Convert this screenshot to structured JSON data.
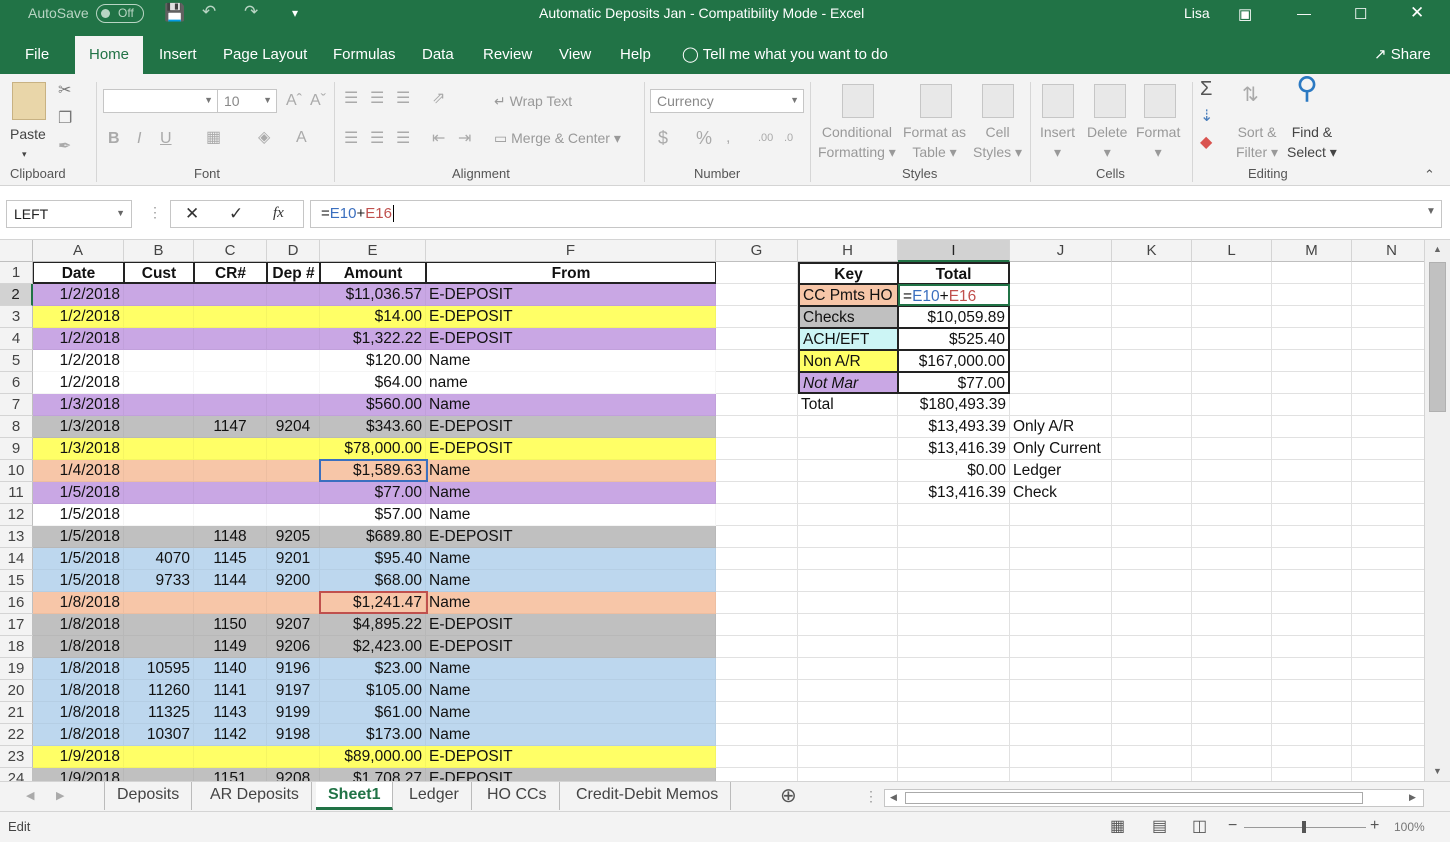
{
  "titlebar": {
    "autosave_label": "AutoSave",
    "autosave_state": "Off",
    "title": "Automatic Deposits Jan  -  Compatibility Mode  -  Excel",
    "user": "Lisa"
  },
  "ribbon_tabs": [
    "File",
    "Home",
    "Insert",
    "Page Layout",
    "Formulas",
    "Data",
    "Review",
    "View",
    "Help"
  ],
  "tell_me": "Tell me what you want to do",
  "share": "Share",
  "ribbon": {
    "paste": "Paste",
    "font_name": "",
    "font_size": "10",
    "wrap_text": "Wrap Text",
    "merge_center": "Merge & Center",
    "number_format": "Currency",
    "conditional_formatting": [
      "Conditional",
      "Formatting"
    ],
    "format_as_table": [
      "Format as",
      "Table"
    ],
    "cell_styles": [
      "Cell",
      "Styles"
    ],
    "insert": "Insert",
    "delete": "Delete",
    "format": "Format",
    "sort_filter": [
      "Sort &",
      "Filter"
    ],
    "find_select": [
      "Find &",
      "Select"
    ],
    "groups": [
      "Clipboard",
      "Font",
      "Alignment",
      "Number",
      "Styles",
      "Cells",
      "Editing"
    ]
  },
  "formula_bar": {
    "name_box": "LEFT",
    "formula": "=E10+E16",
    "fx": "fx"
  },
  "columns": [
    "A",
    "B",
    "C",
    "D",
    "E",
    "F",
    "G",
    "H",
    "I",
    "J",
    "K",
    "L",
    "M",
    "N"
  ],
  "selected_column": "I",
  "header_row": [
    "Date",
    "Cust",
    "CR#",
    "Dep #",
    "Amount",
    "From"
  ],
  "rows": [
    {
      "n": "2",
      "date": "1/2/2018",
      "cust": "",
      "cr": "",
      "dep": "",
      "amount": "$11,036.57",
      "from": "E-DEPOSIT",
      "color": "#c9a7e4"
    },
    {
      "n": "3",
      "date": "1/2/2018",
      "cust": "",
      "cr": "",
      "dep": "",
      "amount": "$14.00",
      "from": "E-DEPOSIT",
      "color": "#ffff66"
    },
    {
      "n": "4",
      "date": "1/2/2018",
      "cust": "",
      "cr": "",
      "dep": "",
      "amount": "$1,322.22",
      "from": "E-DEPOSIT",
      "color": "#c9a7e4"
    },
    {
      "n": "5",
      "date": "1/2/2018",
      "cust": "",
      "cr": "",
      "dep": "",
      "amount": "$120.00",
      "from": "Name",
      "color": "#ffffff"
    },
    {
      "n": "6",
      "date": "1/2/2018",
      "cust": "",
      "cr": "",
      "dep": "",
      "amount": "$64.00",
      "from": "name",
      "color": "#ffffff"
    },
    {
      "n": "7",
      "date": "1/3/2018",
      "cust": "",
      "cr": "",
      "dep": "",
      "amount": "$560.00",
      "from": "Name",
      "color": "#c9a7e4"
    },
    {
      "n": "8",
      "date": "1/3/2018",
      "cust": "",
      "cr": "1147",
      "dep": "9204",
      "amount": "$343.60",
      "from": "E-DEPOSIT",
      "color": "#c0c0c0"
    },
    {
      "n": "9",
      "date": "1/3/2018",
      "cust": "",
      "cr": "",
      "dep": "",
      "amount": "$78,000.00",
      "from": "E-DEPOSIT",
      "color": "#ffff66"
    },
    {
      "n": "10",
      "date": "1/4/2018",
      "cust": "",
      "cr": "",
      "dep": "",
      "amount": "$1,589.63",
      "from": "Name",
      "color": "#f7c6a8"
    },
    {
      "n": "11",
      "date": "1/5/2018",
      "cust": "",
      "cr": "",
      "dep": "",
      "amount": "$77.00",
      "from": "Name",
      "color": "#c9a7e4"
    },
    {
      "n": "12",
      "date": "1/5/2018",
      "cust": "",
      "cr": "",
      "dep": "",
      "amount": "$57.00",
      "from": "Name",
      "color": "#ffffff"
    },
    {
      "n": "13",
      "date": "1/5/2018",
      "cust": "",
      "cr": "1148",
      "dep": "9205",
      "amount": "$689.80",
      "from": "E-DEPOSIT",
      "color": "#c0c0c0"
    },
    {
      "n": "14",
      "date": "1/5/2018",
      "cust": "4070",
      "cr": "1145",
      "dep": "9201",
      "amount": "$95.40",
      "from": "Name",
      "color": "#bdd7ee"
    },
    {
      "n": "15",
      "date": "1/5/2018",
      "cust": "9733",
      "cr": "1144",
      "dep": "9200",
      "amount": "$68.00",
      "from": "Name",
      "color": "#bdd7ee"
    },
    {
      "n": "16",
      "date": "1/8/2018",
      "cust": "",
      "cr": "",
      "dep": "",
      "amount": "$1,241.47",
      "from": "Name",
      "color": "#f7c6a8"
    },
    {
      "n": "17",
      "date": "1/8/2018",
      "cust": "",
      "cr": "1150",
      "dep": "9207",
      "amount": "$4,895.22",
      "from": "E-DEPOSIT",
      "color": "#c0c0c0"
    },
    {
      "n": "18",
      "date": "1/8/2018",
      "cust": "",
      "cr": "1149",
      "dep": "9206",
      "amount": "$2,423.00",
      "from": "E-DEPOSIT",
      "color": "#c0c0c0"
    },
    {
      "n": "19",
      "date": "1/8/2018",
      "cust": "10595",
      "cr": "1140",
      "dep": "9196",
      "amount": "$23.00",
      "from": "Name",
      "color": "#bdd7ee"
    },
    {
      "n": "20",
      "date": "1/8/2018",
      "cust": "11260",
      "cr": "1141",
      "dep": "9197",
      "amount": "$105.00",
      "from": "Name",
      "color": "#bdd7ee"
    },
    {
      "n": "21",
      "date": "1/8/2018",
      "cust": "11325",
      "cr": "1143",
      "dep": "9199",
      "amount": "$61.00",
      "from": "Name",
      "color": "#bdd7ee"
    },
    {
      "n": "22",
      "date": "1/8/2018",
      "cust": "10307",
      "cr": "1142",
      "dep": "9198",
      "amount": "$173.00",
      "from": "Name",
      "color": "#bdd7ee"
    },
    {
      "n": "23",
      "date": "1/9/2018",
      "cust": "",
      "cr": "",
      "dep": "",
      "amount": "$89,000.00",
      "from": "E-DEPOSIT",
      "color": "#ffff66"
    },
    {
      "n": "24",
      "date": "1/9/2018",
      "cust": "",
      "cr": "1151",
      "dep": "9208",
      "amount": "$1,708.27",
      "from": "E-DEPOSIT",
      "color": "#c0c0c0"
    }
  ],
  "key_table": {
    "header": [
      "Key",
      "Total"
    ],
    "rows": [
      {
        "key": "CC Pmts HO",
        "total": "=E10+E16",
        "color": "#f7c6a8",
        "italic": false
      },
      {
        "key": "Checks",
        "total": "$10,059.89",
        "color": "#c0c0c0",
        "italic": false
      },
      {
        "key": "ACH/EFT",
        "total": "$525.40",
        "color": "#ccf5f5",
        "italic": false
      },
      {
        "key": "Non A/R",
        "total": "$167,000.00",
        "color": "#ffff66",
        "italic": false
      },
      {
        "key": "Not Mar",
        "total": "$77.00",
        "color": "#c9a7e4",
        "italic": true
      }
    ],
    "total_label": "Total",
    "total_value": "$180,493.39",
    "summary": [
      {
        "value": "$13,493.39",
        "label": "Only A/R"
      },
      {
        "value": "$13,416.39",
        "label": "Only Current"
      },
      {
        "value": "$0.00",
        "label": "Ledger"
      },
      {
        "value": "$13,416.39",
        "label": "Check"
      }
    ]
  },
  "sheet_tabs": [
    "Deposits",
    "AR Deposits",
    "Sheet1",
    "Ledger",
    "HO CCs",
    "Credit-Debit Memos"
  ],
  "active_sheet": "Sheet1",
  "status": {
    "mode": "Edit",
    "zoom": "100%"
  }
}
